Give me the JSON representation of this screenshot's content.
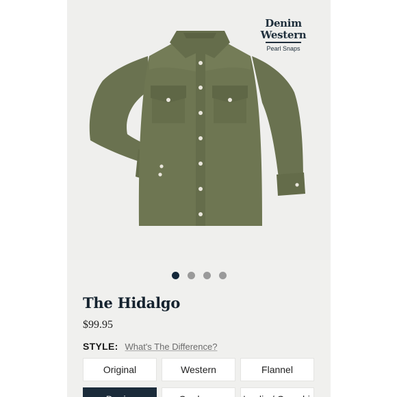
{
  "badge": {
    "line1": "Denim",
    "line2": "Western",
    "sub": "Pearl Snaps"
  },
  "carousel": {
    "dot_count": 4,
    "active_index": 0
  },
  "product": {
    "title": "The Hidalgo",
    "price": "$99.95",
    "shirt_color": "#6e7652"
  },
  "style": {
    "label": "STYLE:",
    "link": "What's The Difference?",
    "options": [
      "Original",
      "Western",
      "Flannel",
      "Denim",
      "Corduroy",
      "Hoodie / Overshirt"
    ],
    "selected": "Denim"
  },
  "colors": {
    "accent": "#1b2b3a",
    "panel_bg": "#f0f0ee"
  }
}
